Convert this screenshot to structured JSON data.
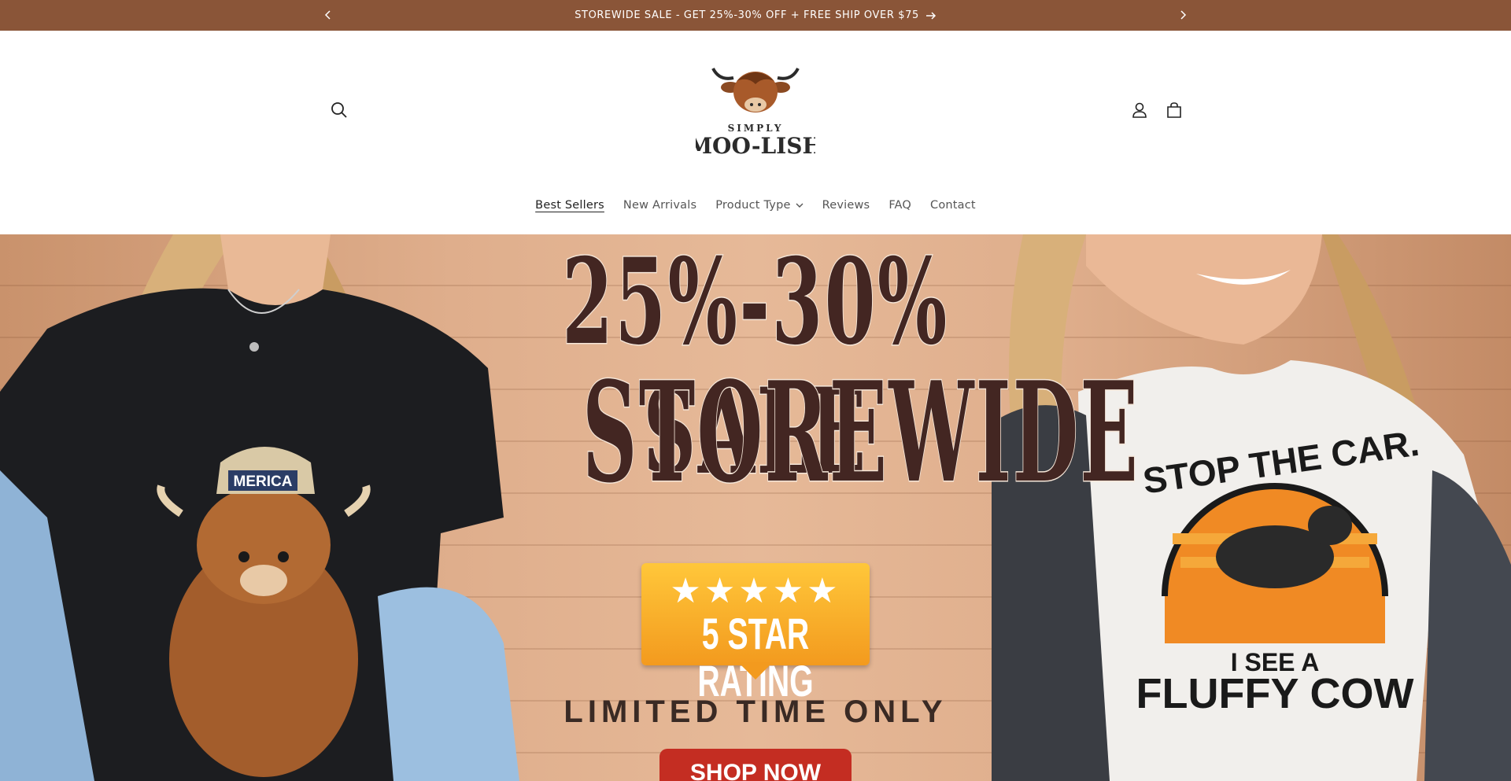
{
  "announcement": {
    "text": "STOREWIDE SALE - GET 25%-30% OFF + FREE SHIP OVER $75",
    "bg_color": "#8a5538",
    "prev_icon": "chevron-left-icon",
    "next_icon": "chevron-right-icon",
    "link_icon": "arrow-right-icon"
  },
  "header": {
    "logo": {
      "top_text": "SIMPLY",
      "main_text": "MOO-LISH"
    },
    "search_icon": "search-icon",
    "account_icon": "user-icon",
    "cart_icon": "cart-icon"
  },
  "nav": {
    "items": [
      {
        "label": "Best Sellers",
        "active": true
      },
      {
        "label": "New Arrivals"
      },
      {
        "label": "Product Type",
        "has_dropdown": true
      },
      {
        "label": "Reviews"
      },
      {
        "label": "FAQ"
      },
      {
        "label": "Contact"
      }
    ]
  },
  "hero": {
    "headline_line1": "25%-30% SALE",
    "headline_line2": "STOREWIDE",
    "badge_stars": "★★★★★",
    "badge_text": "5 STAR RATING",
    "subtext": "LIMITED TIME ONLY",
    "cta_label": "SHOP NOW",
    "left_shirt_text": "MERICA",
    "right_shirt_top": "STOP THE CAR.",
    "right_shirt_mid": "I SEE A",
    "right_shirt_bottom": "FLUFFY COW",
    "colors": {
      "headline": "#432622",
      "cta": "#c42d22",
      "badge": "#f7ad28"
    }
  }
}
